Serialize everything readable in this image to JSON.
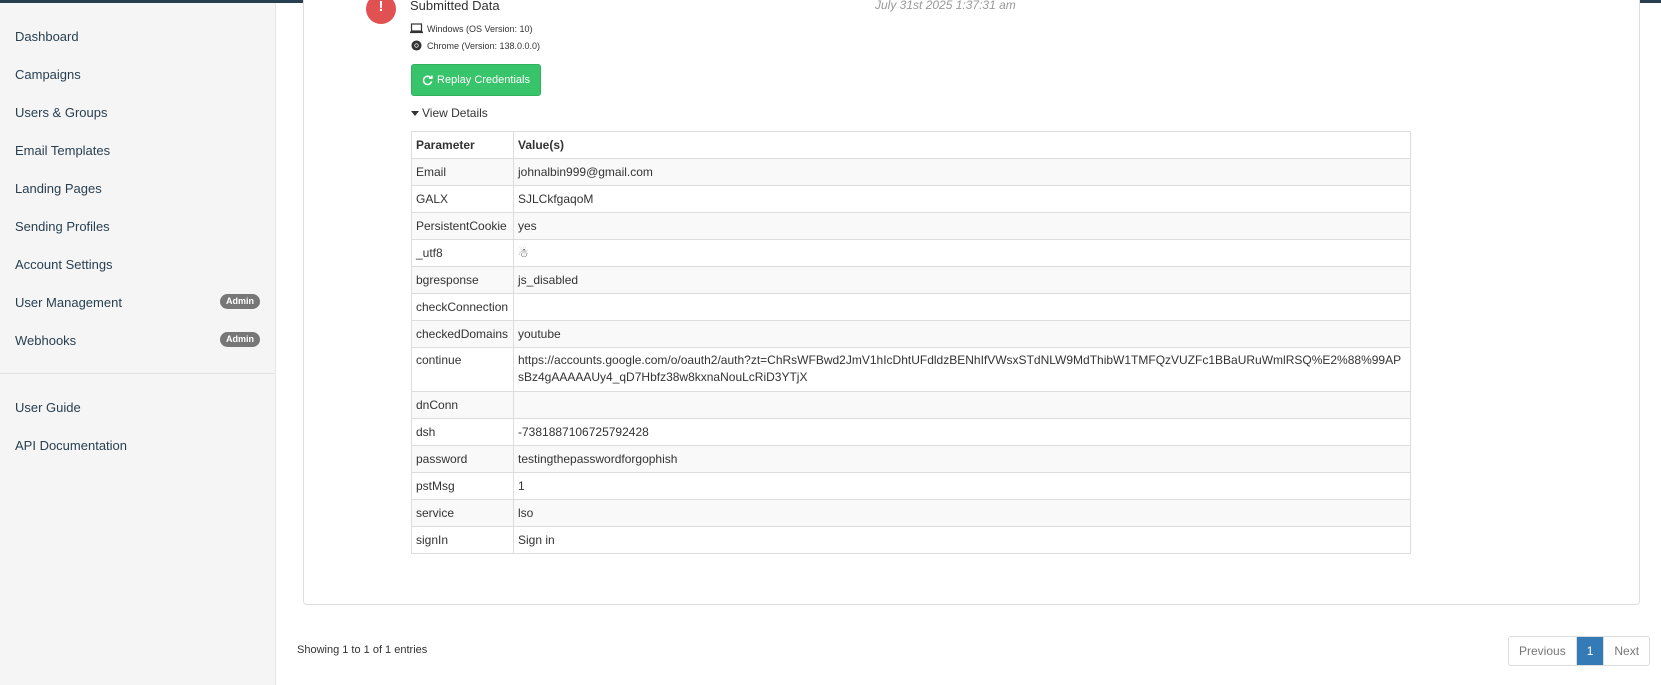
{
  "sidebar": {
    "items": [
      {
        "label": "Dashboard"
      },
      {
        "label": "Campaigns"
      },
      {
        "label": "Users & Groups"
      },
      {
        "label": "Email Templates"
      },
      {
        "label": "Landing Pages"
      },
      {
        "label": "Sending Profiles"
      },
      {
        "label": "Account Settings"
      },
      {
        "label": "User Management",
        "badge": "Admin"
      },
      {
        "label": "Webhooks",
        "badge": "Admin"
      }
    ],
    "secondary": [
      {
        "label": "User Guide"
      },
      {
        "label": "API Documentation"
      }
    ]
  },
  "event": {
    "icon": "!",
    "title": "Submitted Data",
    "date": "July 31st 2025 1:37:31 am",
    "os": "Windows (OS Version: 10)",
    "browser": "Chrome (Version: 138.0.0.0)",
    "replay_label": "Replay Credentials",
    "details_label": "View Details"
  },
  "table": {
    "headers": [
      "Parameter",
      "Value(s)"
    ],
    "rows": [
      {
        "key": "Email",
        "value": "johnalbin999@gmail.com"
      },
      {
        "key": "GALX",
        "value": "SJLCkfgaqoM"
      },
      {
        "key": "PersistentCookie",
        "value": "yes"
      },
      {
        "key": "_utf8",
        "value": "☃"
      },
      {
        "key": "bgresponse",
        "value": "js_disabled"
      },
      {
        "key": "checkConnection",
        "value": ""
      },
      {
        "key": "checkedDomains",
        "value": "youtube"
      },
      {
        "key": "continue",
        "value": "https://accounts.google.com/o/oauth2/auth?zt=ChRsWFBwd2JmV1hIcDhtUFdldzBENhIfVWsxSTdNLW9MdThibW1TMFQzVUZFc1BBaURuWmlRSQ%E2%88%99APsBz4gAAAAAUy4_qD7Hbfz38w8kxnaNouLcRiD3YTjX"
      },
      {
        "key": "dnConn",
        "value": ""
      },
      {
        "key": "dsh",
        "value": "-7381887106725792428"
      },
      {
        "key": "password",
        "value": "testingthepasswordforgophish"
      },
      {
        "key": "pstMsg",
        "value": "1"
      },
      {
        "key": "service",
        "value": "lso"
      },
      {
        "key": "signIn",
        "value": "Sign in"
      }
    ]
  },
  "footer": {
    "entries": "Showing 1 to 1 of 1 entries",
    "previous": "Previous",
    "page": "1",
    "next": "Next"
  },
  "colors": {
    "accent_green": "#37c46a",
    "alert_red": "#e15151",
    "pager_active": "#337ab7",
    "topbar": "#283f50"
  },
  "icons": {
    "alert": "exclamation-icon",
    "os": "laptop-icon",
    "browser": "chrome-icon",
    "replay": "refresh-icon",
    "details": "caret-down-icon"
  }
}
